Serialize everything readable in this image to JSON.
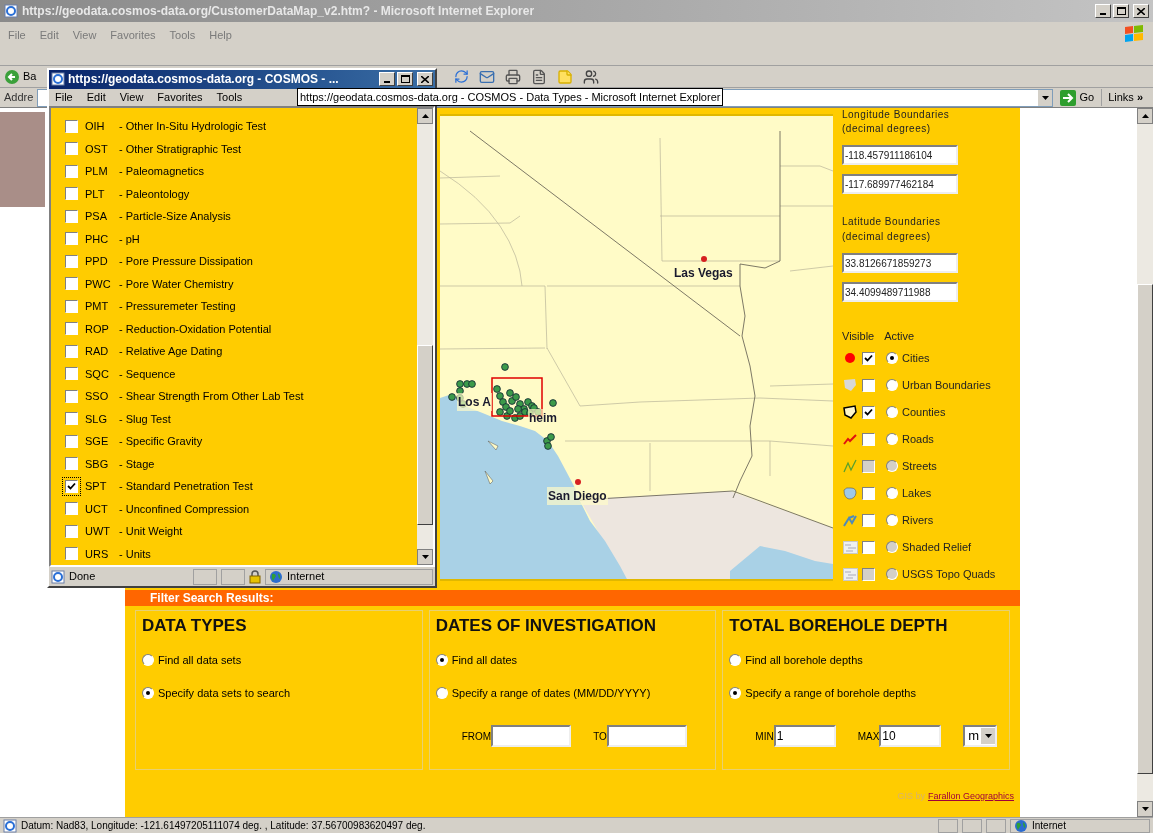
{
  "window": {
    "title": "https://geodata.cosmos-data.org/CustomerDataMap_v2.htm? - Microsoft Internet Explorer"
  },
  "menu": [
    "File",
    "Edit",
    "View",
    "Favorites",
    "Tools",
    "Help"
  ],
  "toolbar": {
    "back_label": "Ba"
  },
  "address_bar": {
    "label": "Addre",
    "go": "Go",
    "links": "Links",
    "links_chevron": "»"
  },
  "tooltip": "https://geodata.cosmos-data.org - COSMOS - Data Types - Microsoft Internet Explorer",
  "popup": {
    "title": "https://geodata.cosmos-data.org - COSMOS - ...",
    "menu": [
      "File",
      "Edit",
      "View",
      "Favorites",
      "Tools"
    ],
    "items": [
      {
        "code": "OIH",
        "name": "- Other In-Situ Hydrologic Test",
        "checked": false,
        "focused": false
      },
      {
        "code": "OST",
        "name": "- Other Stratigraphic Test",
        "checked": false,
        "focused": false
      },
      {
        "code": "PLM",
        "name": "- Paleomagnetics",
        "checked": false,
        "focused": false
      },
      {
        "code": "PLT",
        "name": "- Paleontology",
        "checked": false,
        "focused": false
      },
      {
        "code": "PSA",
        "name": "- Particle-Size Analysis",
        "checked": false,
        "focused": false
      },
      {
        "code": "PHC",
        "name": "- pH",
        "checked": false,
        "focused": false
      },
      {
        "code": "PPD",
        "name": "- Pore Pressure Dissipation",
        "checked": false,
        "focused": false
      },
      {
        "code": "PWC",
        "name": "- Pore Water Chemistry",
        "checked": false,
        "focused": false
      },
      {
        "code": "PMT",
        "name": "- Pressuremeter Testing",
        "checked": false,
        "focused": false
      },
      {
        "code": "ROP",
        "name": "- Reduction-Oxidation Potential",
        "checked": false,
        "focused": false
      },
      {
        "code": "RAD",
        "name": "- Relative Age Dating",
        "checked": false,
        "focused": false
      },
      {
        "code": "SQC",
        "name": "- Sequence",
        "checked": false,
        "focused": false
      },
      {
        "code": "SSO",
        "name": "- Shear Strength From Other Lab Test",
        "checked": false,
        "focused": false
      },
      {
        "code": "SLG",
        "name": "- Slug Test",
        "checked": false,
        "focused": false
      },
      {
        "code": "SGE",
        "name": "- Specific Gravity",
        "checked": false,
        "focused": false
      },
      {
        "code": "SBG",
        "name": "- Stage",
        "checked": false,
        "focused": false
      },
      {
        "code": "SPT",
        "name": "- Standard Penetration Test",
        "checked": true,
        "focused": true
      },
      {
        "code": "UCT",
        "name": "- Unconfined Compression",
        "checked": false,
        "focused": false
      },
      {
        "code": "UWT",
        "name": "- Unit Weight",
        "checked": false,
        "focused": false
      },
      {
        "code": "URS",
        "name": "- Units",
        "checked": false,
        "focused": false
      }
    ],
    "status": "Done",
    "zone": "Internet"
  },
  "map": {
    "labels": [
      {
        "text": "Las Vegas"
      },
      {
        "text": "Los A"
      },
      {
        "text": "heim"
      },
      {
        "text": "San Diego"
      }
    ]
  },
  "boundaries": {
    "longitude_title": "Longitude Boundaries",
    "longitude_unit": "(decimal degrees)",
    "longitude_values": [
      "-118.457911186104",
      "-117.689977462184"
    ],
    "latitude_title": "Latitude Boundaries",
    "latitude_unit": "(decimal degrees)",
    "latitude_values": [
      "33.8126671859273",
      "34.4099489711988"
    ]
  },
  "layers": {
    "headers": [
      "Visible",
      "Active"
    ],
    "items": [
      {
        "name": "Cities",
        "kind": "city",
        "visible": true,
        "visible_disabled": false,
        "selected": true,
        "radio_disabled": false
      },
      {
        "name": "Urban Boundaries",
        "kind": "urban",
        "visible": false,
        "visible_disabled": false,
        "selected": false,
        "radio_disabled": false
      },
      {
        "name": "Counties",
        "kind": "county",
        "visible": true,
        "visible_disabled": false,
        "selected": false,
        "radio_disabled": false
      },
      {
        "name": "Roads",
        "kind": "road",
        "visible": false,
        "visible_disabled": false,
        "selected": false,
        "radio_disabled": false
      },
      {
        "name": "Streets",
        "kind": "street",
        "visible": false,
        "visible_disabled": true,
        "selected": false,
        "radio_disabled": true
      },
      {
        "name": "Lakes",
        "kind": "lake",
        "visible": false,
        "visible_disabled": false,
        "selected": false,
        "radio_disabled": false
      },
      {
        "name": "Rivers",
        "kind": "river",
        "visible": false,
        "visible_disabled": false,
        "selected": false,
        "radio_disabled": false
      },
      {
        "name": "Shaded Relief",
        "kind": "relief",
        "visible": false,
        "visible_disabled": false,
        "selected": false,
        "radio_disabled": true
      },
      {
        "name": "USGS Topo Quads",
        "kind": "relief",
        "visible": false,
        "visible_disabled": true,
        "selected": false,
        "radio_disabled": true
      }
    ]
  },
  "filter": {
    "title": "Filter Search Results:",
    "sections": [
      {
        "title": "DATA TYPES",
        "options": [
          {
            "label": "Find all data sets",
            "selected": false
          },
          {
            "label": "Specify data sets to search",
            "selected": true
          }
        ]
      },
      {
        "title": "DATES OF INVESTIGATION",
        "options": [
          {
            "label": "Find all dates",
            "selected": true
          },
          {
            "label": "Specify a range of dates (MM/DD/YYYY)",
            "selected": false
          }
        ],
        "fields": [
          {
            "label": "FROM"
          },
          {
            "label": "TO"
          }
        ]
      },
      {
        "title": "TOTAL BOREHOLE DEPTH",
        "options": [
          {
            "label": "Find all borehole depths",
            "selected": false
          },
          {
            "label": "Specify a range of borehole depths",
            "selected": true
          }
        ],
        "fields": [
          {
            "label": "MIN",
            "value": "1"
          },
          {
            "label": "MAX",
            "value": "10"
          }
        ],
        "unit": "m"
      }
    ]
  },
  "credit": {
    "prefix": "GIS by",
    "link": "Farallon Geographics"
  },
  "status_bar": {
    "text": "Datum: Nad83, Longitude: -121.61497205111074 deg. , Latitude: 37.56700983620497 deg.",
    "zone": "Internet"
  }
}
